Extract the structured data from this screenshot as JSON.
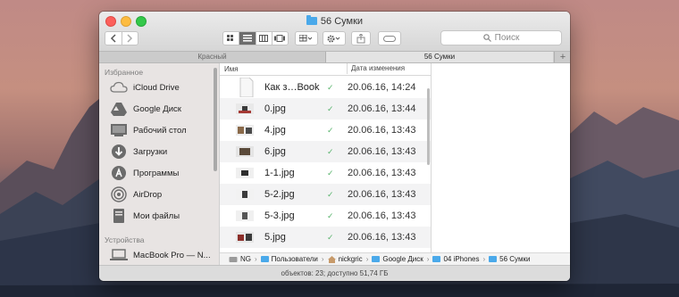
{
  "window": {
    "title": "56 Сумки",
    "title_icon": "folder-icon"
  },
  "toolbar": {
    "back_icon": "chevron-left-icon",
    "forward_icon": "chevron-right-icon",
    "view_modes": [
      "icon-view-icon",
      "list-view-icon",
      "column-view-icon",
      "cover-flow-icon"
    ],
    "active_view": "list-view-icon",
    "search_placeholder": "Поиск"
  },
  "tabs": [
    {
      "label": "Красный",
      "active": false
    },
    {
      "label": "56 Сумки",
      "active": true
    }
  ],
  "sidebar": {
    "favorites_header": "Избранное",
    "favorites": [
      {
        "label": "iCloud Drive",
        "icon": "cloud-icon"
      },
      {
        "label": "Google Диск",
        "icon": "google-drive-icon"
      },
      {
        "label": "Рабочий стол",
        "icon": "desktop-icon"
      },
      {
        "label": "Загрузки",
        "icon": "downloads-icon"
      },
      {
        "label": "Программы",
        "icon": "applications-icon"
      },
      {
        "label": "AirDrop",
        "icon": "airdrop-icon"
      },
      {
        "label": "Мои файлы",
        "icon": "documents-icon"
      }
    ],
    "devices_header": "Устройства",
    "devices": [
      {
        "label": "MacBook Pro — N...",
        "icon": "laptop-icon"
      }
    ]
  },
  "file_list": {
    "columns": [
      "Имя",
      "Дата изменения"
    ],
    "rows": [
      {
        "name": "Как з…Book",
        "date": "20.06.16, 14:24",
        "thumb": "document"
      },
      {
        "name": "0.jpg",
        "date": "20.06.16, 13:44",
        "thumb": "image"
      },
      {
        "name": "4.jpg",
        "date": "20.06.16, 13:43",
        "thumb": "image"
      },
      {
        "name": "6.jpg",
        "date": "20.06.16, 13:43",
        "thumb": "image"
      },
      {
        "name": "1-1.jpg",
        "date": "20.06.16, 13:43",
        "thumb": "image"
      },
      {
        "name": "5-2.jpg",
        "date": "20.06.16, 13:43",
        "thumb": "image"
      },
      {
        "name": "5-3.jpg",
        "date": "20.06.16, 13:43",
        "thumb": "image"
      },
      {
        "name": "5.jpg",
        "date": "20.06.16, 13:43",
        "thumb": "image"
      }
    ],
    "sync_mark": "✓"
  },
  "pathbar": [
    "NG",
    "Пользователи",
    "nickgric",
    "Google Диск",
    "04 iPhones",
    "56 Сумки"
  ],
  "status": "объектов: 23; доступно 51,74 ГБ",
  "colors": {
    "accent": "#4aa9ea",
    "check": "#57b36b"
  }
}
